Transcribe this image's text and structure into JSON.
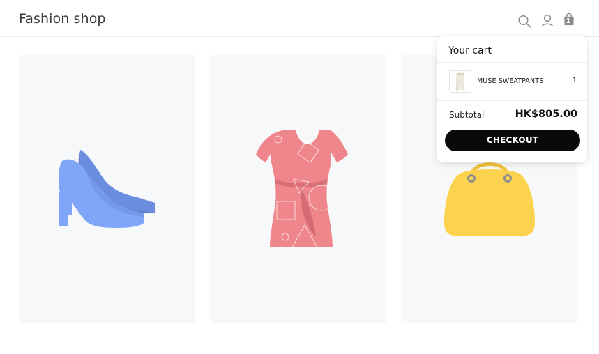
{
  "header": {
    "logo": "Fashion shop",
    "icons": [
      "search-icon",
      "user-icon",
      "shopping-bag-icon"
    ],
    "cart_count": "1"
  },
  "products": [
    {
      "image": "high-heel-shoes",
      "color": "#7fa6f8"
    },
    {
      "image": "dress",
      "color": "#ef868c"
    },
    {
      "image": "handbag",
      "color": "#fcd34f"
    }
  ],
  "cart": {
    "title": "Your cart",
    "items": [
      {
        "name": "MUSE SWEATPANTS",
        "quantity": "1"
      }
    ],
    "subtotal_label": "Subtotal",
    "subtotal_value": "HK$805.00",
    "checkout_label": "CHECKOUT"
  },
  "colors": {
    "card_background": "#f7f8f9",
    "checkout_button": "#0a0a0a"
  }
}
